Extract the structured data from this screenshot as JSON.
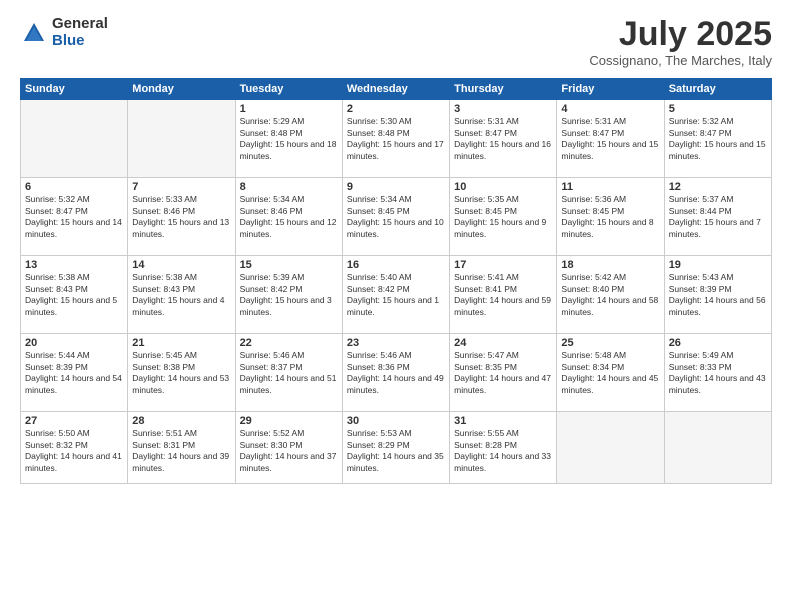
{
  "logo": {
    "general": "General",
    "blue": "Blue"
  },
  "title": "July 2025",
  "location": "Cossignano, The Marches, Italy",
  "days_header": [
    "Sunday",
    "Monday",
    "Tuesday",
    "Wednesday",
    "Thursday",
    "Friday",
    "Saturday"
  ],
  "weeks": [
    [
      {
        "num": "",
        "empty": true
      },
      {
        "num": "",
        "empty": true
      },
      {
        "num": "1",
        "sunrise": "5:29 AM",
        "sunset": "8:48 PM",
        "daylight": "15 hours and 18 minutes."
      },
      {
        "num": "2",
        "sunrise": "5:30 AM",
        "sunset": "8:48 PM",
        "daylight": "15 hours and 17 minutes."
      },
      {
        "num": "3",
        "sunrise": "5:31 AM",
        "sunset": "8:47 PM",
        "daylight": "15 hours and 16 minutes."
      },
      {
        "num": "4",
        "sunrise": "5:31 AM",
        "sunset": "8:47 PM",
        "daylight": "15 hours and 15 minutes."
      },
      {
        "num": "5",
        "sunrise": "5:32 AM",
        "sunset": "8:47 PM",
        "daylight": "15 hours and 15 minutes."
      }
    ],
    [
      {
        "num": "6",
        "sunrise": "5:32 AM",
        "sunset": "8:47 PM",
        "daylight": "15 hours and 14 minutes."
      },
      {
        "num": "7",
        "sunrise": "5:33 AM",
        "sunset": "8:46 PM",
        "daylight": "15 hours and 13 minutes."
      },
      {
        "num": "8",
        "sunrise": "5:34 AM",
        "sunset": "8:46 PM",
        "daylight": "15 hours and 12 minutes."
      },
      {
        "num": "9",
        "sunrise": "5:34 AM",
        "sunset": "8:45 PM",
        "daylight": "15 hours and 10 minutes."
      },
      {
        "num": "10",
        "sunrise": "5:35 AM",
        "sunset": "8:45 PM",
        "daylight": "15 hours and 9 minutes."
      },
      {
        "num": "11",
        "sunrise": "5:36 AM",
        "sunset": "8:45 PM",
        "daylight": "15 hours and 8 minutes."
      },
      {
        "num": "12",
        "sunrise": "5:37 AM",
        "sunset": "8:44 PM",
        "daylight": "15 hours and 7 minutes."
      }
    ],
    [
      {
        "num": "13",
        "sunrise": "5:38 AM",
        "sunset": "8:43 PM",
        "daylight": "15 hours and 5 minutes."
      },
      {
        "num": "14",
        "sunrise": "5:38 AM",
        "sunset": "8:43 PM",
        "daylight": "15 hours and 4 minutes."
      },
      {
        "num": "15",
        "sunrise": "5:39 AM",
        "sunset": "8:42 PM",
        "daylight": "15 hours and 3 minutes."
      },
      {
        "num": "16",
        "sunrise": "5:40 AM",
        "sunset": "8:42 PM",
        "daylight": "15 hours and 1 minute."
      },
      {
        "num": "17",
        "sunrise": "5:41 AM",
        "sunset": "8:41 PM",
        "daylight": "14 hours and 59 minutes."
      },
      {
        "num": "18",
        "sunrise": "5:42 AM",
        "sunset": "8:40 PM",
        "daylight": "14 hours and 58 minutes."
      },
      {
        "num": "19",
        "sunrise": "5:43 AM",
        "sunset": "8:39 PM",
        "daylight": "14 hours and 56 minutes."
      }
    ],
    [
      {
        "num": "20",
        "sunrise": "5:44 AM",
        "sunset": "8:39 PM",
        "daylight": "14 hours and 54 minutes."
      },
      {
        "num": "21",
        "sunrise": "5:45 AM",
        "sunset": "8:38 PM",
        "daylight": "14 hours and 53 minutes."
      },
      {
        "num": "22",
        "sunrise": "5:46 AM",
        "sunset": "8:37 PM",
        "daylight": "14 hours and 51 minutes."
      },
      {
        "num": "23",
        "sunrise": "5:46 AM",
        "sunset": "8:36 PM",
        "daylight": "14 hours and 49 minutes."
      },
      {
        "num": "24",
        "sunrise": "5:47 AM",
        "sunset": "8:35 PM",
        "daylight": "14 hours and 47 minutes."
      },
      {
        "num": "25",
        "sunrise": "5:48 AM",
        "sunset": "8:34 PM",
        "daylight": "14 hours and 45 minutes."
      },
      {
        "num": "26",
        "sunrise": "5:49 AM",
        "sunset": "8:33 PM",
        "daylight": "14 hours and 43 minutes."
      }
    ],
    [
      {
        "num": "27",
        "sunrise": "5:50 AM",
        "sunset": "8:32 PM",
        "daylight": "14 hours and 41 minutes."
      },
      {
        "num": "28",
        "sunrise": "5:51 AM",
        "sunset": "8:31 PM",
        "daylight": "14 hours and 39 minutes."
      },
      {
        "num": "29",
        "sunrise": "5:52 AM",
        "sunset": "8:30 PM",
        "daylight": "14 hours and 37 minutes."
      },
      {
        "num": "30",
        "sunrise": "5:53 AM",
        "sunset": "8:29 PM",
        "daylight": "14 hours and 35 minutes."
      },
      {
        "num": "31",
        "sunrise": "5:55 AM",
        "sunset": "8:28 PM",
        "daylight": "14 hours and 33 minutes."
      },
      {
        "num": "",
        "empty": true
      },
      {
        "num": "",
        "empty": true
      }
    ]
  ]
}
